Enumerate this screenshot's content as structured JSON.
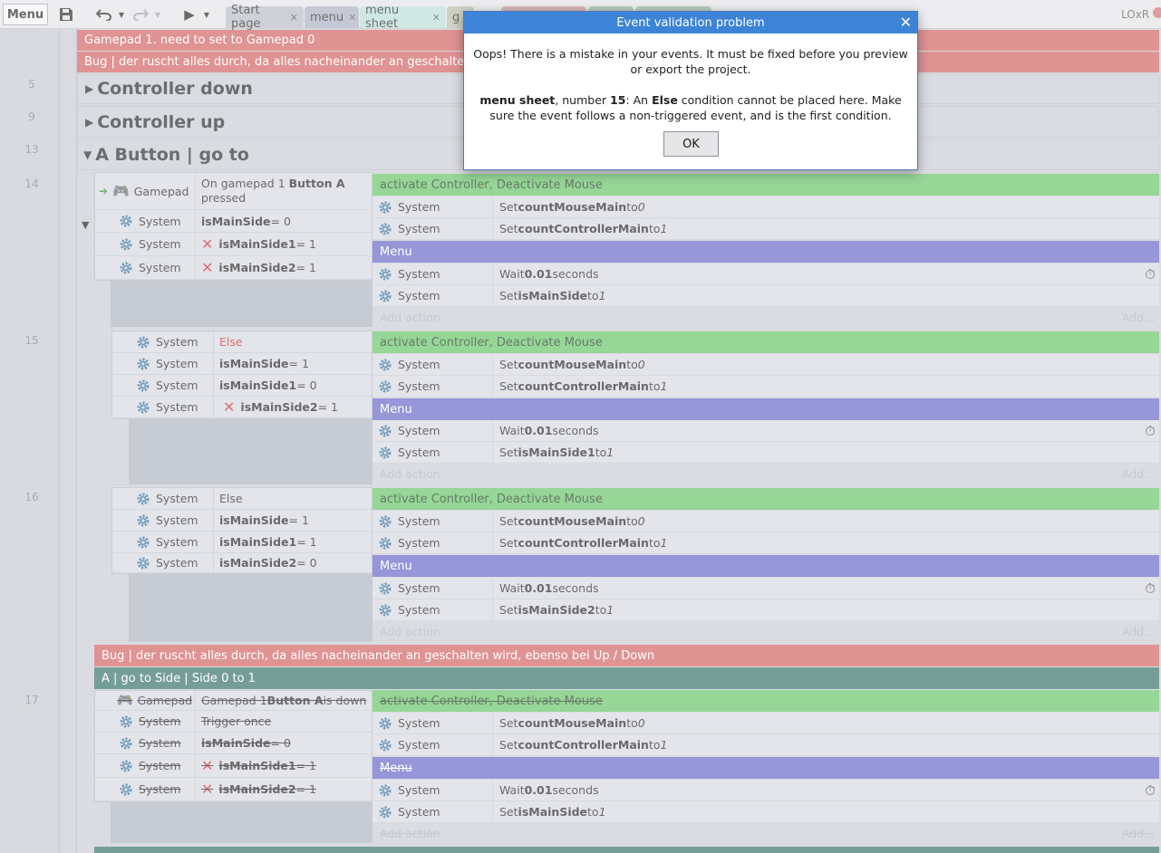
{
  "toolbar": {
    "menu_label": "Menu",
    "tabs": [
      {
        "label": "Start page"
      },
      {
        "label": "menu"
      },
      {
        "label": "menu sheet"
      },
      {
        "label": "g"
      }
    ],
    "user_label": "LOxR"
  },
  "comments": {
    "top1": "Gamepad 1. need to set to Gamepad 0",
    "top2": "Bug | der ruscht alles durch, da alles nacheinander an geschalten wird, e",
    "bug": "Bug | der ruscht alles durch, da alles nacheinander an geschalten wird, ebenso bei Up / Down",
    "agroup": "A | go to Side | Side 0 to 1"
  },
  "groups": [
    {
      "line": "5",
      "title": "Controller down"
    },
    {
      "line": "9",
      "title": "Controller up"
    },
    {
      "line": "13",
      "title": "A Button | go to"
    }
  ],
  "events": {
    "e14": {
      "line": "14",
      "c1_obj": "Gamepad",
      "c1_txt_a": "On gamepad 1 ",
      "c1_txt_b": "Button A",
      "c1_txt_c": "pressed",
      "c2_obj": "System",
      "c2_var": "isMainSide",
      "c2_rest": " = 0",
      "c3_obj": "System",
      "c3_var": "isMainSide1",
      "c3_rest": " = 1",
      "c4_obj": "System",
      "c4_var": "isMainSide2",
      "c4_rest": " = 1",
      "header1": "activate Controller, Deactivate Mouse",
      "a1_obj": "System",
      "a1_pre": "Set ",
      "a1_var": "countMouseMain",
      "a1_mid": " to ",
      "a1_val": "0",
      "a2_obj": "System",
      "a2_pre": "Set ",
      "a2_var": "countControllerMain",
      "a2_mid": " to ",
      "a2_val": "1",
      "header2": "Menu",
      "a3_obj": "System",
      "a3_pre": "Wait ",
      "a3_var": "0.01",
      "a3_mid": " seconds",
      "a4_obj": "System",
      "a4_pre": "Set ",
      "a4_var": "isMainSide",
      "a4_mid": " to ",
      "a4_val": "1",
      "add_action": "Add action",
      "add_short": "Add..."
    },
    "e15": {
      "line": "15",
      "c1_obj": "System",
      "c1_txt": "Else",
      "c2_obj": "System",
      "c2_var": "isMainSide",
      "c2_rest": " = 1",
      "c3_obj": "System",
      "c3_var": "isMainSide1",
      "c3_rest": " = 0",
      "c4_obj": "System",
      "c4_var": "isMainSide2",
      "c4_rest": " = 1",
      "header1": "activate Controller, Deactivate Mouse",
      "a1_obj": "System",
      "a1_pre": "Set ",
      "a1_var": "countMouseMain",
      "a1_mid": " to ",
      "a1_val": "0",
      "a2_obj": "System",
      "a2_pre": "Set ",
      "a2_var": "countControllerMain",
      "a2_mid": " to ",
      "a2_val": "1",
      "header2": "Menu",
      "a3_obj": "System",
      "a3_pre": "Wait ",
      "a3_var": "0.01",
      "a3_mid": " seconds",
      "a4_obj": "System",
      "a4_pre": "Set ",
      "a4_var": "isMainSide1",
      "a4_mid": " to ",
      "a4_val": "1",
      "add_action": "Add action",
      "add_short": "Add..."
    },
    "e16": {
      "line": "16",
      "c1_obj": "System",
      "c1_txt": "Else",
      "c2_obj": "System",
      "c2_var": "isMainSide",
      "c2_rest": " = 1",
      "c3_obj": "System",
      "c3_var": "isMainSide1",
      "c3_rest": " = 1",
      "c4_obj": "System",
      "c4_var": "isMainSide2",
      "c4_rest": " = 0",
      "header1": "activate Controller, Deactivate Mouse",
      "a1_obj": "System",
      "a1_pre": "Set ",
      "a1_var": "countMouseMain",
      "a1_mid": " to ",
      "a1_val": "0",
      "a2_obj": "System",
      "a2_pre": "Set ",
      "a2_var": "countControllerMain",
      "a2_mid": " to ",
      "a2_val": "1",
      "header2": "Menu",
      "a3_obj": "System",
      "a3_pre": "Wait ",
      "a3_var": "0.01",
      "a3_mid": " seconds",
      "a4_obj": "System",
      "a4_pre": "Set ",
      "a4_var": "isMainSide2",
      "a4_mid": " to ",
      "a4_val": "1",
      "add_action": "Add action",
      "add_short": "Add..."
    },
    "e17": {
      "line": "17",
      "c1_obj": "Gamepad",
      "c1_txt_a": "Gamepad 1 ",
      "c1_txt_b": "Button A",
      "c1_txt_c": " is down",
      "c2_obj": "System",
      "c2_txt": "Trigger once",
      "c3_obj": "System",
      "c3_var": "isMainSide",
      "c3_rest": " = 0",
      "c4_obj": "System",
      "c4_var": "isMainSide1",
      "c4_rest": " = 1",
      "c5_obj": "System",
      "c5_var": "isMainSide2",
      "c5_rest": " = 1",
      "header1": "activate Controller, Deactivate Mouse",
      "a1_obj": "System",
      "a1_pre": "Set ",
      "a1_var": "countMouseMain",
      "a1_mid": " to ",
      "a1_val": "0",
      "a2_obj": "System",
      "a2_pre": "Set ",
      "a2_var": "countControllerMain",
      "a2_mid": " to ",
      "a2_val": "1",
      "header2": "Menu",
      "a3_obj": "System",
      "a3_pre": "Wait ",
      "a3_var": "0.01",
      "a3_mid": " seconds",
      "a4_obj": "System",
      "a4_pre": "Set ",
      "a4_var": "isMainSide",
      "a4_mid": " to ",
      "a4_val": "1",
      "add_action": "Add action",
      "add_short": "Add..."
    }
  },
  "dialog": {
    "title": "Event validation problem",
    "line1": "Oops! There is a mistake in your events. It must be fixed before you preview",
    "line2": "or export the project.",
    "d_sheet": "menu sheet",
    "d_t1": ", number ",
    "d_num": "15",
    "d_t2": ": An ",
    "d_else": "Else",
    "d_t3": " condition cannot be placed here. Make",
    "d_line4": "sure the event follows a non-triggered event, and is the first condition.",
    "ok_label": "OK"
  },
  "colors": {
    "action_header": "#5fc05f",
    "menu_header": "#5f5fc4",
    "comment": "#d05a5a",
    "group_comment": "#2d6a63",
    "dialog_title": "#3d84d6"
  }
}
